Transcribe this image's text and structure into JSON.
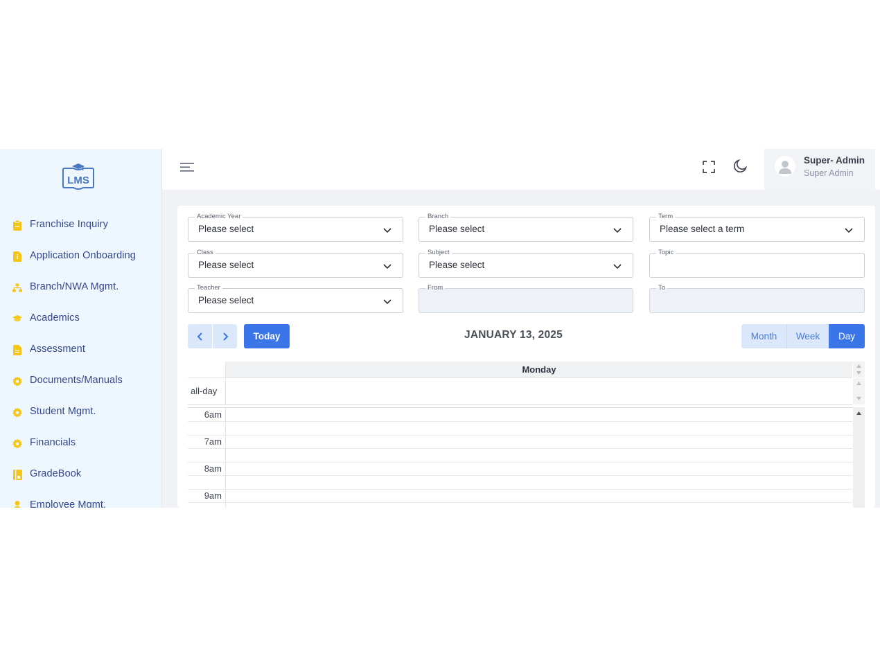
{
  "sidebar": {
    "logo_text": "LMS",
    "items": [
      {
        "label": "Franchise Inquiry",
        "icon": "clipboard-icon"
      },
      {
        "label": "Application Onboarding",
        "icon": "document-icon"
      },
      {
        "label": "Branch/NWA Mgmt.",
        "icon": "hierarchy-icon"
      },
      {
        "label": "Academics",
        "icon": "graduation-cap-icon"
      },
      {
        "label": "Assessment",
        "icon": "file-icon"
      },
      {
        "label": "Documents/Manuals",
        "icon": "gear-icon"
      },
      {
        "label": "Student Mgmt.",
        "icon": "gear-icon"
      },
      {
        "label": "Financials",
        "icon": "gear-icon"
      },
      {
        "label": "GradeBook",
        "icon": "book-icon"
      },
      {
        "label": "Employee Mgmt.",
        "icon": "person-icon"
      }
    ],
    "icon_color": "#f5c518"
  },
  "header": {
    "user_name": "Super- Admin",
    "user_role": "Super Admin"
  },
  "filters": {
    "academic_year": {
      "label": "Academic Year",
      "value": "Please select"
    },
    "branch": {
      "label": "Branch",
      "value": "Please select"
    },
    "term": {
      "label": "Term",
      "value": "Please select a term"
    },
    "class": {
      "label": "Class",
      "value": "Please select"
    },
    "subject": {
      "label": "Subject",
      "value": "Please select"
    },
    "topic": {
      "label": "Topic",
      "value": ""
    },
    "teacher": {
      "label": "Teacher",
      "value": "Please select"
    },
    "from": {
      "label": "From",
      "value": ""
    },
    "to": {
      "label": "To",
      "value": ""
    }
  },
  "calendar": {
    "today_label": "Today",
    "title": "JANUARY 13, 2025",
    "views": {
      "month": "Month",
      "week": "Week",
      "day": "Day"
    },
    "active_view": "Day",
    "day_header": "Monday",
    "allday_label": "all-day",
    "time_slots": [
      "6am",
      "7am",
      "8am",
      "9am"
    ],
    "accent_color": "#3a76e8"
  }
}
